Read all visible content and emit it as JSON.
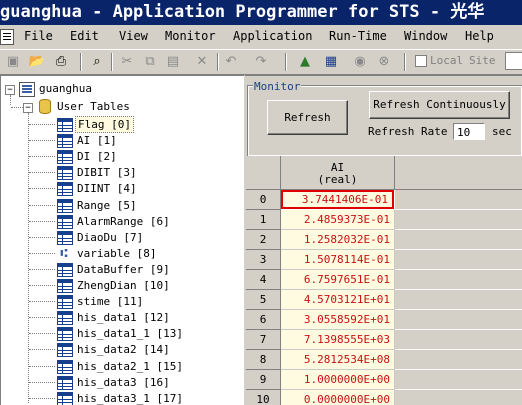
{
  "window": {
    "title": "guanghua - Application Programmer for STS - 光华"
  },
  "menu": [
    "File",
    "Edit",
    "View",
    "Monitor",
    "Application",
    "Run-Time",
    "Window",
    "Help"
  ],
  "toolbar": {
    "icons": [
      "save-icon",
      "open-icon",
      "print-icon",
      "find-icon",
      "cut-icon",
      "copy-icon",
      "paste-icon",
      "delete-icon",
      "undo-icon",
      "redo-icon",
      "compile-icon",
      "download-icon",
      "run-icon",
      "stop-icon"
    ],
    "local_label": "Local",
    "site_label": "Site"
  },
  "tree": {
    "root": "guanghua",
    "folder": "User Tables",
    "items": [
      {
        "label": "Flag [0]",
        "icon": "table-icon",
        "selected": true
      },
      {
        "label": "AI [1]",
        "icon": "table-icon",
        "selected": false
      },
      {
        "label": "DI [2]",
        "icon": "table-icon",
        "selected": false
      },
      {
        "label": "DIBIT [3]",
        "icon": "table-icon",
        "selected": false
      },
      {
        "label": "DIINT [4]",
        "icon": "table-icon",
        "selected": false
      },
      {
        "label": "Range [5]",
        "icon": "table-icon",
        "selected": false
      },
      {
        "label": "AlarmRange [6]",
        "icon": "table-icon",
        "selected": false
      },
      {
        "label": "DiaoDu [7]",
        "icon": "table-icon",
        "selected": false
      },
      {
        "label": "variable [8]",
        "icon": "variable-icon",
        "selected": false
      },
      {
        "label": "DataBuffer [9]",
        "icon": "table-icon",
        "selected": false
      },
      {
        "label": "ZhengDian [10]",
        "icon": "table-icon",
        "selected": false
      },
      {
        "label": "stime [11]",
        "icon": "table-icon",
        "selected": false
      },
      {
        "label": "his_data1 [12]",
        "icon": "table-icon",
        "selected": false
      },
      {
        "label": "his_data1_1 [13]",
        "icon": "table-icon",
        "selected": false
      },
      {
        "label": "his_data2 [14]",
        "icon": "table-icon",
        "selected": false
      },
      {
        "label": "his_data2_1 [15]",
        "icon": "table-icon",
        "selected": false
      },
      {
        "label": "his_data3 [16]",
        "icon": "table-icon",
        "selected": false
      },
      {
        "label": "his_data3_1 [17]",
        "icon": "table-icon",
        "selected": false
      }
    ]
  },
  "monitor": {
    "group_label": "Monitor",
    "refresh_label": "Refresh",
    "refresh_continuously_label": "Refresh Continuously",
    "refresh_rate_label": "Refresh Rate",
    "refresh_rate_value": "10",
    "sec_label": "sec"
  },
  "grid": {
    "column_header": "AI",
    "column_subheader": "(real)",
    "rows": [
      {
        "index": "0",
        "value": "3.7441406E-01"
      },
      {
        "index": "1",
        "value": "2.4859373E-01"
      },
      {
        "index": "2",
        "value": "1.2582032E-01"
      },
      {
        "index": "3",
        "value": "1.5078114E-01"
      },
      {
        "index": "4",
        "value": "6.7597651E-01"
      },
      {
        "index": "5",
        "value": "4.5703121E+01"
      },
      {
        "index": "6",
        "value": "3.0558592E+01"
      },
      {
        "index": "7",
        "value": "7.1398555E+03"
      },
      {
        "index": "8",
        "value": "5.2812534E+08"
      },
      {
        "index": "9",
        "value": "1.0000000E+00"
      },
      {
        "index": "10",
        "value": "0.0000000E+00"
      }
    ],
    "value_color": "#c81010",
    "selected_color": "#e00000"
  }
}
